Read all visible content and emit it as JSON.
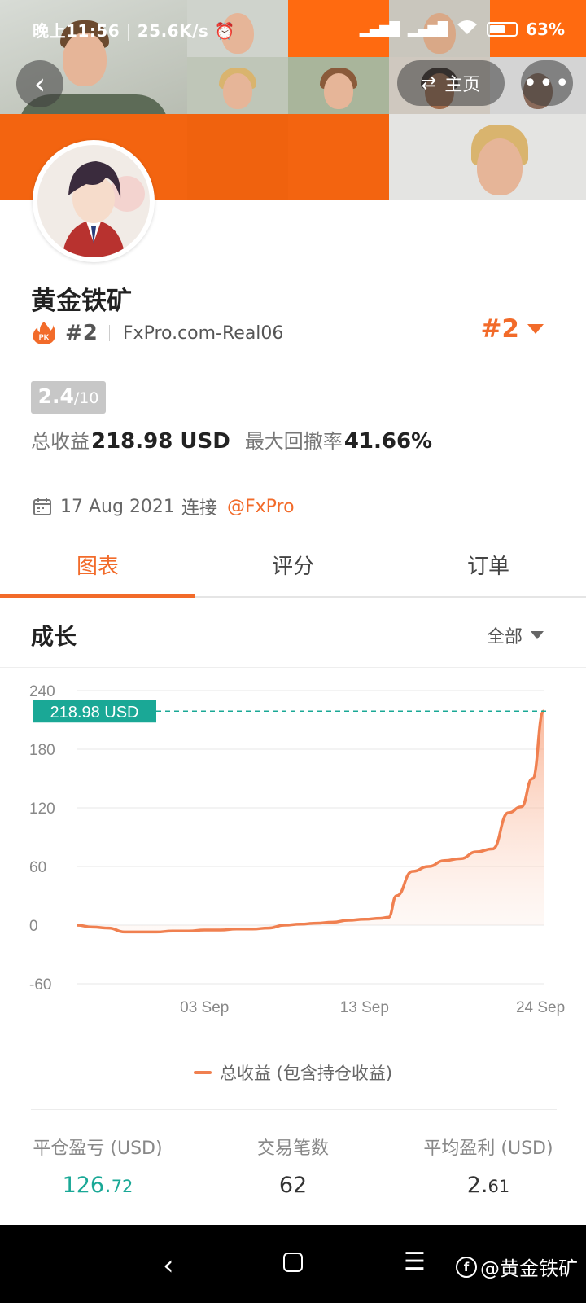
{
  "status_bar": {
    "time": "晚上11:56",
    "speed": "25.6K/s",
    "battery": "63%"
  },
  "header": {
    "home_label": "主页"
  },
  "profile": {
    "name": "黄金铁矿",
    "rank": "#2",
    "server": "FxPro.com-Real06",
    "rank_right": "#2",
    "score": "2.4",
    "score_max": "/10",
    "total_profit_label": "总收益",
    "total_profit_value": "218.98 USD",
    "max_drawdown_label": "最大回撤率",
    "max_drawdown_value": "41.66%",
    "connected_date": "17 Aug 2021",
    "connected_label": "连接",
    "connected_broker": "@FxPro"
  },
  "tabs": [
    "图表",
    "评分",
    "订单"
  ],
  "section": {
    "title": "成长",
    "filter": "全部"
  },
  "chart_data": {
    "type": "area",
    "title": "",
    "xlabel": "",
    "ylabel": "",
    "ylim": [
      -60,
      240
    ],
    "yticks": [
      "240",
      "180",
      "120",
      "60",
      "0",
      "-60"
    ],
    "xticks": [
      "03 Sep",
      "13 Sep",
      "24 Sep"
    ],
    "xtick_positions": [
      8,
      18,
      29
    ],
    "current_value_label": "218.98 USD",
    "current_value": 218.98,
    "series": [
      {
        "name": "总收益 (包含持仓收益)",
        "color": "#f08050",
        "x": [
          0,
          1,
          2,
          3,
          4,
          5,
          6,
          7,
          8,
          9,
          10,
          11,
          12,
          13,
          14,
          15,
          16,
          17,
          18,
          19,
          19.5,
          20,
          21,
          22,
          23,
          24,
          25,
          26,
          27,
          27.8,
          28.5,
          29.2
        ],
        "values": [
          0,
          -2,
          -3,
          -7,
          -7,
          -7,
          -6,
          -6,
          -5,
          -5,
          -4,
          -4,
          -3,
          0,
          1,
          2,
          3,
          5,
          6,
          7,
          8,
          30,
          55,
          60,
          66,
          68,
          75,
          78,
          115,
          121,
          150,
          218.98
        ]
      }
    ]
  },
  "legend": {
    "label": "总收益 (包含持仓收益)"
  },
  "summary": [
    {
      "label": "平仓盈亏 (USD)",
      "value_main": "126.",
      "value_small": "72",
      "color": "#1aa896"
    },
    {
      "label": "交易笔数",
      "value_main": "62",
      "value_small": "",
      "color": "#333333"
    },
    {
      "label": "平均盈利 (USD)",
      "value_main": "2.",
      "value_small": "61",
      "color": "#333333"
    }
  ],
  "watermark": "@黄金铁矿"
}
